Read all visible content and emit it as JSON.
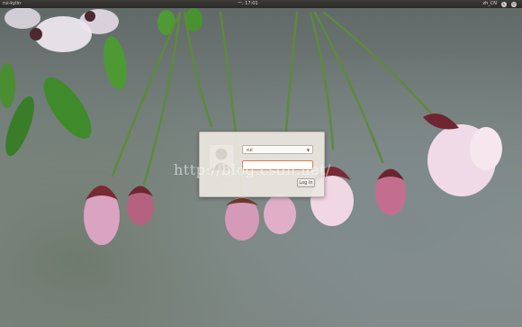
{
  "top_panel": {
    "hostname": "rui-kylin",
    "clock": "一, 17:01",
    "language": "zh_CN",
    "indicators": [
      "accessibility-icon",
      "power-icon"
    ]
  },
  "login": {
    "username": "rui",
    "password_value": "",
    "login_button_label": "Log In"
  },
  "watermark": "http://blog.csdn.net/",
  "colors": {
    "panel": "#2b2a27",
    "dialog_bg": "#ece8e1",
    "focus_border": "#e07a4c"
  }
}
